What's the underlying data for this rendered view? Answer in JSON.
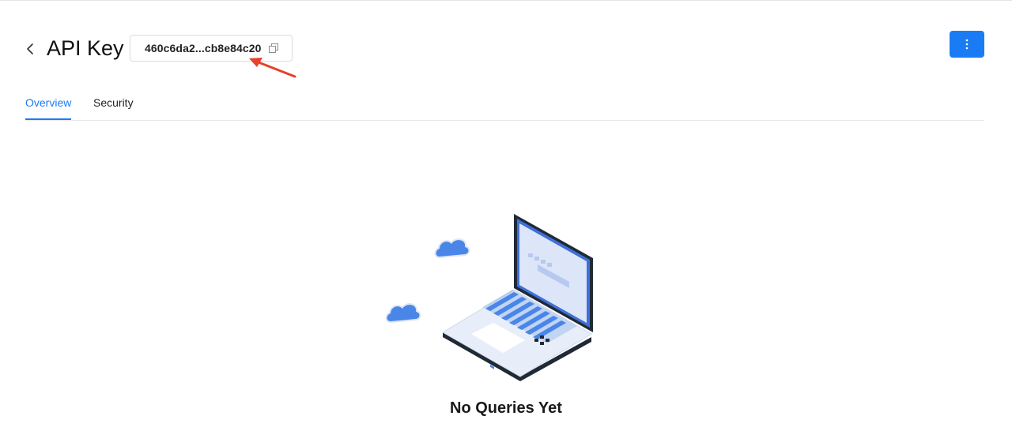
{
  "header": {
    "title": "API Key",
    "key_value": "460c6da2...cb8e84c20"
  },
  "tabs": [
    {
      "label": "Overview",
      "active": true
    },
    {
      "label": "Security",
      "active": false
    }
  ],
  "empty_state": {
    "title": "No Queries Yet"
  },
  "icons": {
    "back": "chevron-left-icon",
    "copy": "copy-icon",
    "more": "more-vertical-icon"
  },
  "colors": {
    "accent": "#1a7cf5",
    "annotation_arrow": "#e8402a"
  }
}
